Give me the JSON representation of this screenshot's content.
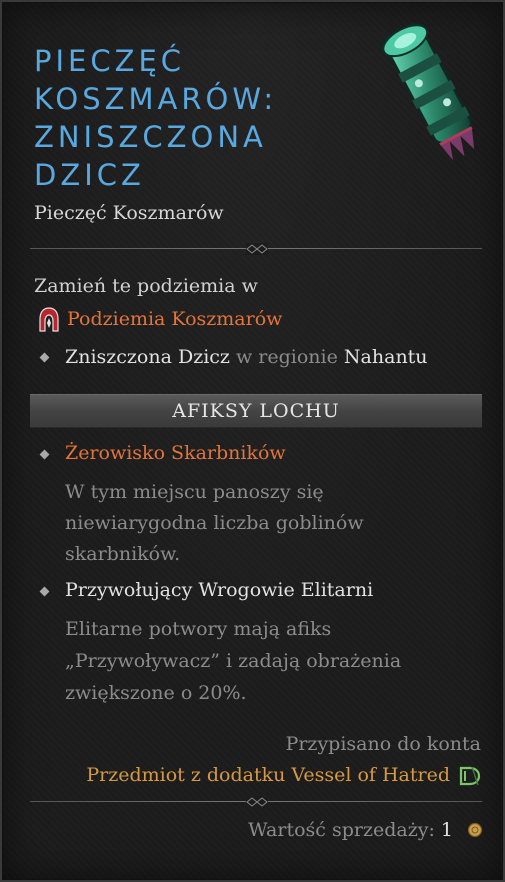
{
  "item": {
    "title_lines": [
      "PIECZĘĆ",
      "KOSZMARÓW:",
      "ZNISZCZONA",
      "DZICZ"
    ],
    "type": "Pieczęć Koszmarów"
  },
  "transform": {
    "intro": "Zamień te podziemia w",
    "target": "Podziemia Koszmarów",
    "dungeon_name": "Zniszczona Dzicz",
    "in_region": "w regionie",
    "region": "Nahantu"
  },
  "affixes": {
    "header": "AFIKSY LOCHU",
    "list": [
      {
        "name": "Żerowisko Skarbników",
        "desc_lines": [
          "W tym miejscu panoszy się",
          "niewiarygodna liczba goblinów",
          "skarbników."
        ]
      },
      {
        "name": "Przywołujący Wrogowie Elitarni",
        "desc_lines": [
          "Elitarne potwory mają afiks",
          "„Przywoływacz” i zadają obrażenia",
          "zwiększone o 20%."
        ]
      }
    ]
  },
  "footer": {
    "account_bound": "Przypisano do konta",
    "expansion": "Przedmiot z dodatku Vessel of Hatred",
    "sell_label": "Wartość sprzedaży:",
    "sell_value": "1"
  },
  "colors": {
    "title": "#5aa8e0",
    "orange": "#e4743a",
    "gold": "#d79a44",
    "grey": "#8c8c8c"
  },
  "icons": {
    "item": "nightmare-sigil-icon",
    "dungeon": "nightmare-dungeon-icon",
    "expansion": "vessel-of-hatred-icon",
    "coin": "gold-coin-icon"
  }
}
